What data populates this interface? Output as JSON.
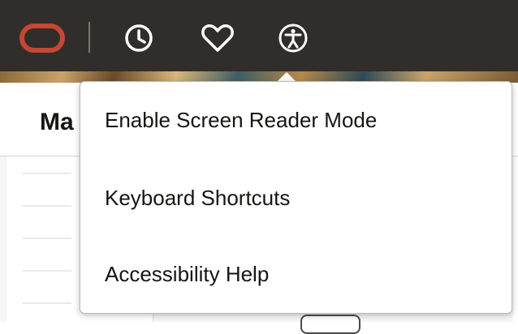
{
  "header": {
    "icons": [
      "oracle-logo",
      "recent-history-icon",
      "favorites-heart-icon",
      "accessibility-icon"
    ]
  },
  "page": {
    "title": "Ma"
  },
  "accessibility_menu": {
    "items": [
      {
        "label": "Enable Screen Reader Mode"
      },
      {
        "label": "Keyboard Shortcuts"
      },
      {
        "label": "Accessibility Help"
      }
    ]
  },
  "colors": {
    "header_bg": "#312d2a",
    "oracle_red": "#c74634",
    "icon_white": "#ffffff"
  }
}
